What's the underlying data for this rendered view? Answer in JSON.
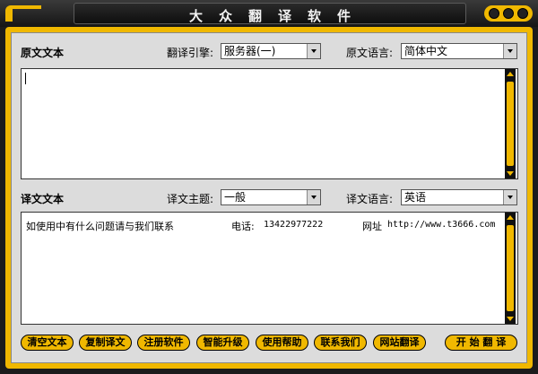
{
  "window": {
    "title": "大众翻译软件"
  },
  "source": {
    "label": "原文文本",
    "engine_label": "翻译引擎:",
    "engine_value": "服务器(一)",
    "lang_label": "原文语言:",
    "lang_value": "简体中文",
    "text": ""
  },
  "target": {
    "label": "译文文本",
    "topic_label": "译文主题:",
    "topic_value": "一般",
    "lang_label": "译文语言:",
    "lang_value": "英语",
    "info_text": "如使用中有什么问题请与我们联系",
    "phone_label": "电话:",
    "phone_value": "13422977222",
    "site_label": "网址",
    "site_value": "http://www.t3666.com"
  },
  "buttons": {
    "clear": "清空文本",
    "copy": "复制译文",
    "register": "注册软件",
    "upgrade": "智能升级",
    "help": "使用帮助",
    "contact": "联系我们",
    "web": "网站翻译",
    "start": "开 始 翻 译"
  },
  "colors": {
    "accent": "#f0b800",
    "frame_dark": "#1c1c1c",
    "panel": "#dcdcdc"
  }
}
